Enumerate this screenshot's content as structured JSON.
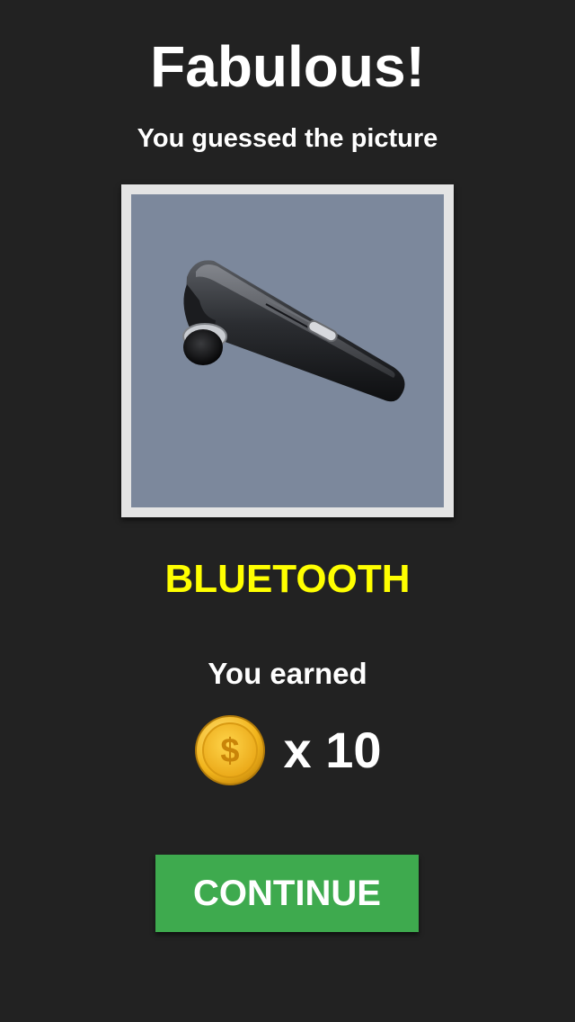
{
  "header": {
    "title": "Fabulous!",
    "subtitle": "You guessed the picture"
  },
  "puzzle": {
    "image_icon": "bluetooth-headset-image",
    "answer": "BLUETOOTH"
  },
  "reward": {
    "label": "You earned",
    "coin_icon": "dollar-coin-icon",
    "amount": "x 10"
  },
  "actions": {
    "continue_label": "CONTINUE"
  },
  "colors": {
    "background": "#222222",
    "answer": "#ffff00",
    "button": "#3eaa4e",
    "frame": "#e4e4e4",
    "picture_bg": "#7c889c"
  }
}
